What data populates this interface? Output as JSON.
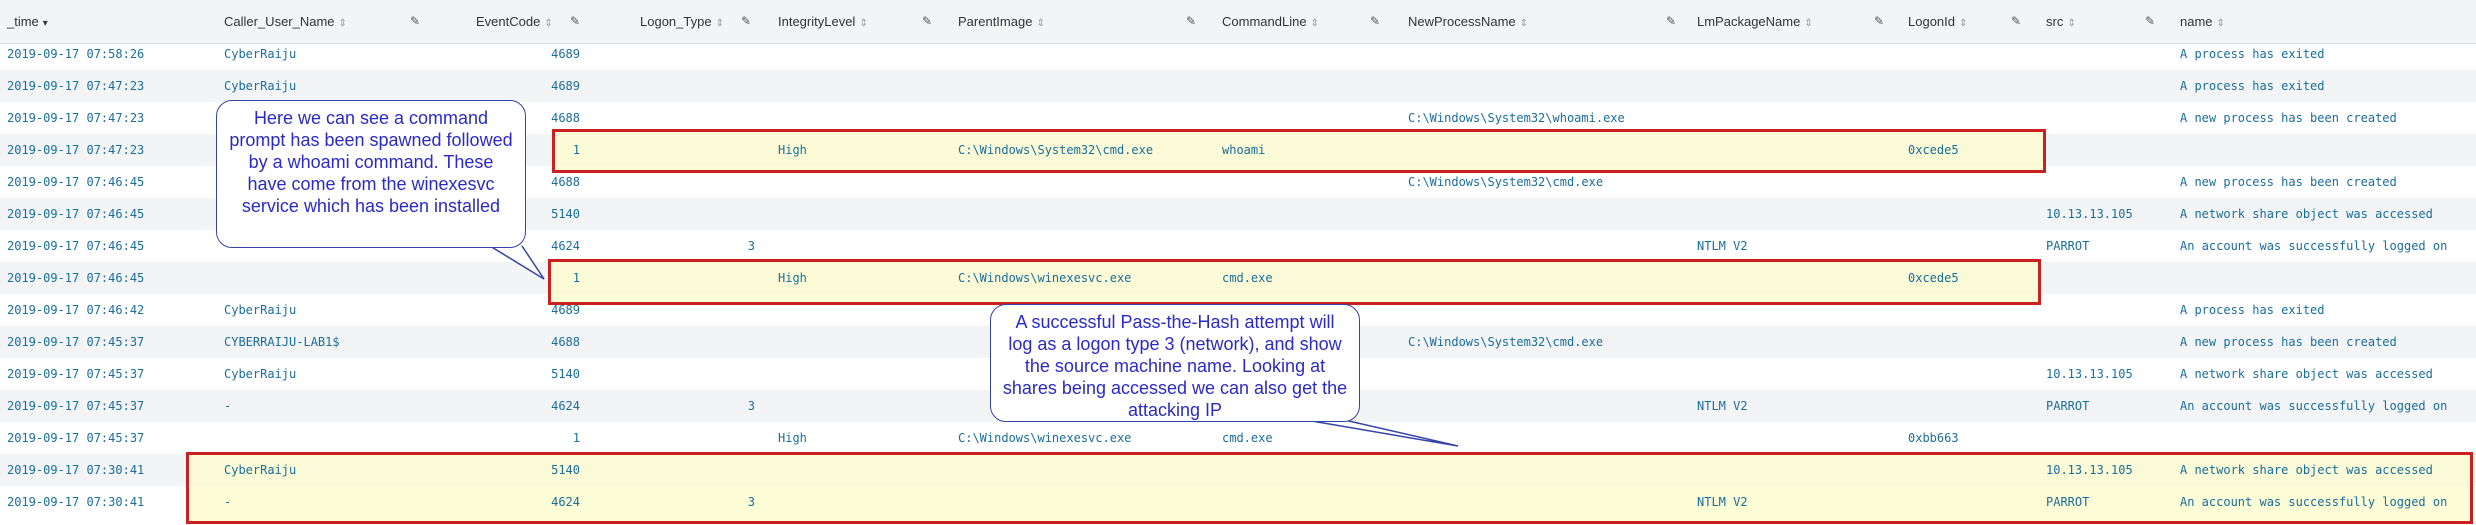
{
  "columns": [
    {
      "key": "time",
      "label": "_time",
      "sort": "▾",
      "active": true
    },
    {
      "key": "caller",
      "label": "Caller_User_Name",
      "sort": "⇕"
    },
    {
      "key": "eventcode",
      "label": "EventCode",
      "sort": "⇕"
    },
    {
      "key": "logon",
      "label": "Logon_Type",
      "sort": "⇕"
    },
    {
      "key": "integrity",
      "label": "IntegrityLevel",
      "sort": "⇕"
    },
    {
      "key": "parent",
      "label": "ParentImage",
      "sort": "⇕"
    },
    {
      "key": "cmd",
      "label": "CommandLine",
      "sort": "⇕"
    },
    {
      "key": "newproc",
      "label": "NewProcessName",
      "sort": "⇕"
    },
    {
      "key": "lm",
      "label": "LmPackageName",
      "sort": "⇕"
    },
    {
      "key": "logonid",
      "label": "LogonId",
      "sort": "⇕"
    },
    {
      "key": "src",
      "label": "src",
      "sort": "⇕"
    },
    {
      "key": "name",
      "label": "name",
      "sort": "⇕"
    }
  ],
  "edit_icon": "pencil-icon",
  "rows": [
    {
      "time": "2019-09-17 07:58:26",
      "caller": "CyberRaiju",
      "eventcode": "4689",
      "logon": "",
      "integrity": "",
      "parent": "",
      "cmd": "",
      "newproc": "",
      "lm": "",
      "logonid": "",
      "src": "",
      "name": "A process has exited"
    },
    {
      "time": "2019-09-17 07:47:23",
      "caller": "CyberRaiju",
      "eventcode": "4689",
      "logon": "",
      "integrity": "",
      "parent": "",
      "cmd": "",
      "newproc": "",
      "lm": "",
      "logonid": "",
      "src": "",
      "name": "A process has exited"
    },
    {
      "time": "2019-09-17 07:47:23",
      "caller": "",
      "eventcode": "4688",
      "logon": "",
      "integrity": "",
      "parent": "",
      "cmd": "",
      "newproc": "C:\\Windows\\System32\\whoami.exe",
      "lm": "",
      "logonid": "",
      "src": "",
      "name": "A new process has been created"
    },
    {
      "time": "2019-09-17 07:47:23",
      "caller": "",
      "eventcode": "1",
      "logon": "",
      "integrity": "High",
      "parent": "C:\\Windows\\System32\\cmd.exe",
      "cmd": "whoami",
      "newproc": "",
      "lm": "",
      "logonid": "0xcede5",
      "src": "",
      "name": ""
    },
    {
      "time": "2019-09-17 07:46:45",
      "caller": "",
      "eventcode": "4688",
      "logon": "",
      "integrity": "",
      "parent": "",
      "cmd": "",
      "newproc": "C:\\Windows\\System32\\cmd.exe",
      "lm": "",
      "logonid": "",
      "src": "",
      "name": "A new process has been created"
    },
    {
      "time": "2019-09-17 07:46:45",
      "caller": "",
      "eventcode": "5140",
      "logon": "",
      "integrity": "",
      "parent": "",
      "cmd": "",
      "newproc": "",
      "lm": "",
      "logonid": "",
      "src": "10.13.13.105",
      "name": "A network share object was accessed"
    },
    {
      "time": "2019-09-17 07:46:45",
      "caller": "",
      "eventcode": "4624",
      "logon": "3",
      "integrity": "",
      "parent": "",
      "cmd": "",
      "newproc": "",
      "lm": "NTLM V2",
      "logonid": "",
      "src": "PARROT",
      "name": "An account was successfully logged on"
    },
    {
      "time": "2019-09-17 07:46:45",
      "caller": "",
      "eventcode": "1",
      "logon": "",
      "integrity": "High",
      "parent": "C:\\Windows\\winexesvc.exe",
      "cmd": "cmd.exe",
      "newproc": "",
      "lm": "",
      "logonid": "0xcede5",
      "src": "",
      "name": ""
    },
    {
      "time": "2019-09-17 07:46:42",
      "caller": "CyberRaiju",
      "eventcode": "4689",
      "logon": "",
      "integrity": "",
      "parent": "",
      "cmd": "",
      "newproc": "",
      "lm": "",
      "logonid": "",
      "src": "",
      "name": "A process has exited"
    },
    {
      "time": "2019-09-17 07:45:37",
      "caller": "CYBERRAIJU-LAB1$",
      "eventcode": "4688",
      "logon": "",
      "integrity": "",
      "parent": "",
      "cmd": "",
      "newproc": "C:\\Windows\\System32\\cmd.exe",
      "lm": "",
      "logonid": "",
      "src": "",
      "name": "A new process has been created"
    },
    {
      "time": "2019-09-17 07:45:37",
      "caller": "CyberRaiju",
      "eventcode": "5140",
      "logon": "",
      "integrity": "",
      "parent": "",
      "cmd": "",
      "newproc": "",
      "lm": "",
      "logonid": "",
      "src": "10.13.13.105",
      "name": "A network share object was accessed"
    },
    {
      "time": "2019-09-17 07:45:37",
      "caller": "-",
      "eventcode": "4624",
      "logon": "3",
      "integrity": "",
      "parent": "",
      "cmd": "",
      "newproc": "",
      "lm": "NTLM V2",
      "logonid": "",
      "src": "PARROT",
      "name": "An account was successfully logged on"
    },
    {
      "time": "2019-09-17 07:45:37",
      "caller": "",
      "eventcode": "1",
      "logon": "",
      "integrity": "High",
      "parent": "C:\\Windows\\winexesvc.exe",
      "cmd": "cmd.exe",
      "newproc": "",
      "lm": "",
      "logonid": "0xbb663",
      "src": "",
      "name": ""
    },
    {
      "time": "2019-09-17 07:30:41",
      "caller": "CyberRaiju",
      "eventcode": "5140",
      "logon": "",
      "integrity": "",
      "parent": "",
      "cmd": "",
      "newproc": "",
      "lm": "",
      "logonid": "",
      "src": "10.13.13.105",
      "name": "A network share object was accessed"
    },
    {
      "time": "2019-09-17 07:30:41",
      "caller": "-",
      "eventcode": "4624",
      "logon": "3",
      "integrity": "",
      "parent": "",
      "cmd": "",
      "newproc": "",
      "lm": "NTLM V2",
      "logonid": "",
      "src": "PARROT",
      "name": "An account was successfully logged on"
    }
  ],
  "annotations": {
    "callout1": "Here we can see a command prompt has been spawned followed by a whoami command. These have come from the winexesvc service which has been installed",
    "callout2": "A successful Pass-the-Hash attempt will log as a logon type 3 (network), and show the source machine name. Looking at shares being accessed we can also get the attacking IP"
  },
  "colors": {
    "value_text": "#1a6d9c",
    "highlight_border": "#cc1f1f",
    "highlight_fill": "#fbfbd0",
    "callout_text": "#2a2ac8",
    "callout_border": "#3344a8",
    "header_bg": "#f2f4f5"
  }
}
